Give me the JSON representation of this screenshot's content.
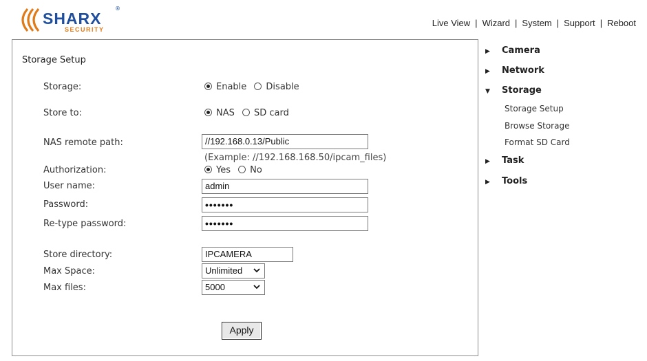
{
  "header": {
    "brand_name": "SHARX",
    "brand_tagline": "SECURITY",
    "brand_reg": "®",
    "nav": [
      "Live View",
      "Wizard",
      "System",
      "Support",
      "Reboot"
    ]
  },
  "form": {
    "title": "Storage Setup",
    "storage": {
      "label": "Storage:",
      "options": [
        "Enable",
        "Disable"
      ],
      "selected": "Enable"
    },
    "store_to": {
      "label": "Store to:",
      "options": [
        "NAS",
        "SD card"
      ],
      "selected": "NAS"
    },
    "nas_path": {
      "label": "NAS remote path:",
      "value": "//192.168.0.13/Public",
      "example": "(Example: //192.168.168.50/ipcam_files)"
    },
    "authorization": {
      "label": "Authorization:",
      "options": [
        "Yes",
        "No"
      ],
      "selected": "Yes"
    },
    "user_name": {
      "label": "User name:",
      "value": "admin"
    },
    "password": {
      "label": "Password:",
      "value": "•••••••"
    },
    "retype_password": {
      "label": "Re-type password:",
      "value": "•••••••"
    },
    "store_directory": {
      "label": "Store directory:",
      "value": "IPCAMERA"
    },
    "max_space": {
      "label": "Max Space:",
      "value": "Unlimited"
    },
    "max_files": {
      "label": "Max files:",
      "value": "5000"
    },
    "apply_label": "Apply"
  },
  "sidebar": {
    "categories": [
      {
        "label": "Camera",
        "expanded": false
      },
      {
        "label": "Network",
        "expanded": false
      },
      {
        "label": "Storage",
        "expanded": true,
        "items": [
          "Storage Setup",
          "Browse Storage",
          "Format SD Card"
        ]
      },
      {
        "label": "Task",
        "expanded": false
      },
      {
        "label": "Tools",
        "expanded": false
      }
    ]
  },
  "colors": {
    "brand_blue": "#1f4e9c",
    "brand_orange": "#e07b1a",
    "panel_border": "#8a8a8a"
  }
}
